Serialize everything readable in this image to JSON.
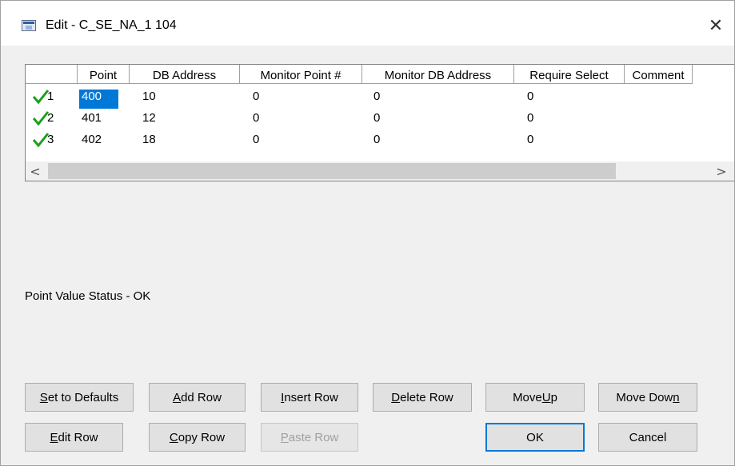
{
  "window": {
    "title": "Edit - C_SE_NA_1 104",
    "close_glyph": "✕"
  },
  "grid": {
    "columns": [
      "",
      "Point",
      "DB Address",
      "Monitor Point #",
      "Monitor DB Address",
      "Require Select",
      "Comment"
    ],
    "rows": [
      {
        "num": "1",
        "point": "400",
        "db_address": "10",
        "monitor_point": "0",
        "monitor_db_address": "0",
        "require_select": "0",
        "comment": ""
      },
      {
        "num": "2",
        "point": "401",
        "db_address": "12",
        "monitor_point": "0",
        "monitor_db_address": "0",
        "require_select": "0",
        "comment": ""
      },
      {
        "num": "3",
        "point": "402",
        "db_address": "18",
        "monitor_point": "0",
        "monitor_db_address": "0",
        "require_select": "0",
        "comment": ""
      }
    ],
    "scroll_left_glyph": "<",
    "scroll_right_glyph": ">"
  },
  "status_text": "Point Value Status - OK",
  "buttons": {
    "set_defaults": {
      "pre": "",
      "u": "S",
      "post": "et to Defaults"
    },
    "add_row": {
      "pre": "",
      "u": "A",
      "post": "dd Row"
    },
    "insert_row": {
      "pre": "",
      "u": "I",
      "post": "nsert Row"
    },
    "delete_row": {
      "pre": "",
      "u": "D",
      "post": "elete Row"
    },
    "move_up": {
      "pre": "Move ",
      "u": "U",
      "post": "p"
    },
    "move_down": {
      "pre": "Move Dow",
      "u": "n",
      "post": ""
    },
    "edit_row": {
      "pre": "",
      "u": "E",
      "post": "dit Row"
    },
    "copy_row": {
      "pre": "",
      "u": "C",
      "post": "opy Row"
    },
    "paste_row": {
      "pre": "",
      "u": "P",
      "post": "aste Row"
    },
    "ok": {
      "pre": "OK",
      "u": "",
      "post": ""
    },
    "cancel": {
      "pre": "Cancel",
      "u": "",
      "post": ""
    }
  },
  "colors": {
    "selection": "#0078d7",
    "check": "#1e9e1e"
  }
}
